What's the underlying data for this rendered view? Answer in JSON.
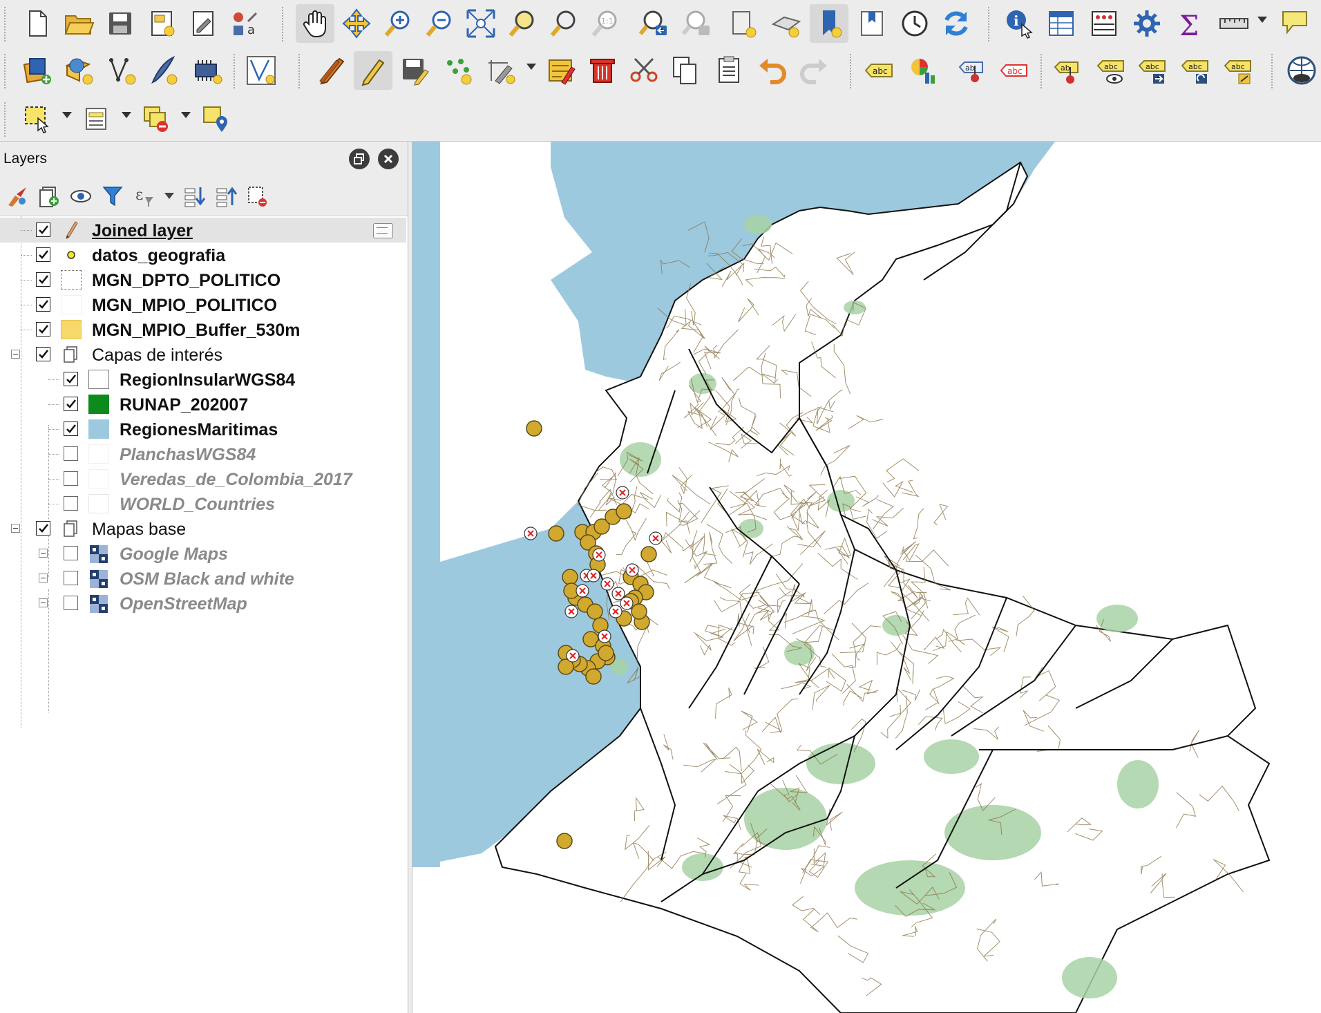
{
  "layers_panel": {
    "title": "Layers",
    "layers": [
      {
        "name": "Joined layer",
        "checked": true,
        "symbol": "pencil-icon",
        "style": "bold-underline",
        "selected": true
      },
      {
        "name": "datos_geografia",
        "checked": true,
        "symbol": "yellow-point",
        "style": "bold"
      },
      {
        "name": "MGN_DPTO_POLITICO",
        "checked": true,
        "symbol": "dashed-outline",
        "style": "bold"
      },
      {
        "name": "MGN_MPIO_POLITICO",
        "checked": true,
        "symbol": "blank",
        "style": "bold"
      },
      {
        "name": "MGN_MPIO_Buffer_530m",
        "checked": true,
        "symbol": "yellow-fill",
        "style": "bold"
      },
      {
        "name": "Capas de interés",
        "checked": true,
        "symbol": "group-icon",
        "style": "group",
        "expanded": true
      },
      {
        "name": "RegionInsularWGS84",
        "checked": true,
        "symbol": "white-fill",
        "style": "bold"
      },
      {
        "name": "RUNAP_202007",
        "checked": true,
        "symbol": "green-fill",
        "style": "bold"
      },
      {
        "name": "RegionesMaritimas",
        "checked": true,
        "symbol": "blue-fill",
        "style": "bold"
      },
      {
        "name": "PlanchasWGS84",
        "checked": false,
        "symbol": "blank",
        "style": "disabled"
      },
      {
        "name": "Veredas_de_Colombia_2017",
        "checked": false,
        "symbol": "blank",
        "style": "disabled"
      },
      {
        "name": "WORLD_Countries",
        "checked": false,
        "symbol": "blank",
        "style": "disabled"
      },
      {
        "name": "Mapas base",
        "checked": true,
        "symbol": "group-icon",
        "style": "group",
        "expanded": true
      },
      {
        "name": "Google Maps",
        "checked": false,
        "symbol": "raster-icon",
        "style": "disabled"
      },
      {
        "name": "OSM Black and white",
        "checked": false,
        "symbol": "raster-icon",
        "style": "disabled"
      },
      {
        "name": "OpenStreetMap",
        "checked": false,
        "symbol": "raster-icon",
        "style": "disabled"
      }
    ]
  },
  "map": {
    "colors": {
      "sea": "#9dc9de",
      "protected_areas": "#a8d2a4",
      "municipal_borders": "#8b7549",
      "department_borders": "#111111",
      "points": "#d1a92e"
    }
  },
  "toolbar": {
    "row1_icons": [
      "new-project-icon",
      "open-project-icon",
      "save-project-icon",
      "new-print-layout-icon",
      "layout-manager-icon",
      "style-manager-icon",
      "pan-map-icon",
      "pan-to-selection-icon",
      "zoom-in-icon",
      "zoom-out-icon",
      "zoom-full-icon",
      "zoom-to-selection-icon",
      "zoom-to-layer-icon",
      "zoom-native-icon",
      "zoom-last-icon",
      "zoom-next-icon",
      "new-map-view-icon",
      "new-3d-view-icon",
      "new-bookmark-icon",
      "show-bookmarks-icon",
      "temporal-controller-icon",
      "refresh-icon",
      "identify-features-icon",
      "open-attribute-table-icon",
      "field-calculator-icon",
      "processing-toolbox-icon",
      "statistical-summary-icon",
      "measure-line-icon",
      "map-tips-icon"
    ],
    "row2_icons": [
      "data-source-manager-icon",
      "new-geopackage-layer-icon",
      "digitize-vertex-icon",
      "new-spatialite-layer-icon",
      "new-virtual-layer-icon",
      "vertex-tool-icon",
      "current-edits-icon",
      "toggle-editing-icon",
      "save-layer-edits-icon",
      "add-point-feature-icon",
      "digitize-feature-icon",
      "modify-attributes-icon",
      "delete-selected-icon",
      "cut-features-icon",
      "copy-features-icon",
      "paste-features-icon",
      "undo-icon",
      "redo-icon",
      "layer-labeling-icon",
      "layer-diagram-icon",
      "highlight-pinned-labels-icon",
      "toggle-labels-icon",
      "pin-labels-icon",
      "show-hide-labels-icon",
      "move-label-icon",
      "rotate-label-icon",
      "change-label-icon",
      "quickmapservices-icon"
    ],
    "row3_icons": [
      "select-features-icon",
      "select-by-value-icon",
      "deselect-features-icon",
      "select-by-location-icon"
    ]
  }
}
